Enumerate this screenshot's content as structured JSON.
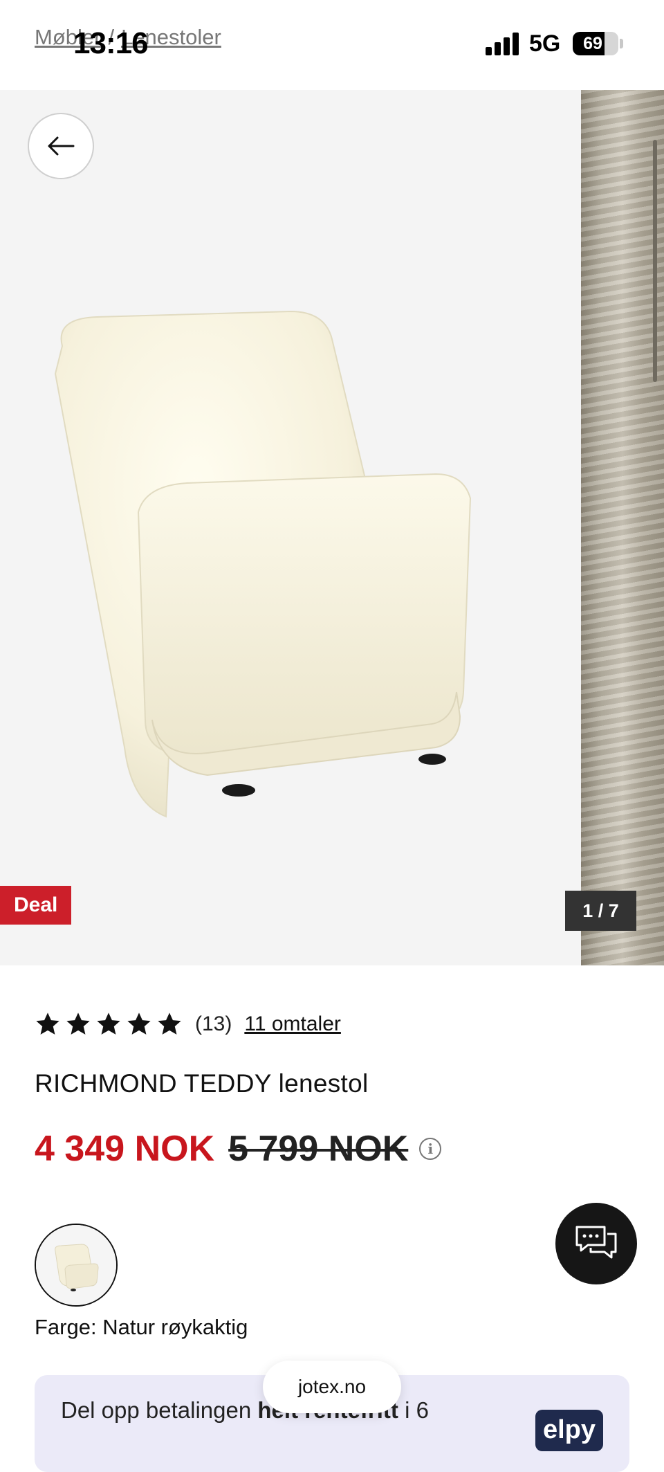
{
  "status_bar": {
    "time": "13:16",
    "network": "5G",
    "battery": "69",
    "battery_fraction": 0.69
  },
  "breadcrumb": {
    "items": [
      "Møbler",
      "Lenestoler"
    ],
    "separator": "/"
  },
  "gallery": {
    "counter": "1 / 7",
    "deal_badge": "Deal",
    "back_icon": "arrow-left-icon"
  },
  "product": {
    "rating": {
      "stars": 5,
      "count_text": "(13)",
      "reviews_link": "11 omtaler"
    },
    "title": "RICHMOND TEDDY lenestol",
    "price_now": "4 349 NOK",
    "price_old": "5 799 NOK",
    "color_label": "Farge: Natur røykaktig"
  },
  "payment_banner": {
    "text_prefix": "Del opp betalingen ",
    "text_bold": "helt rentefritt",
    "text_suffix": " i 6",
    "logo": "elpy"
  },
  "browser": {
    "url": "jotex.no"
  },
  "colors": {
    "deal": "#cc1f2a",
    "price": "#c8161d",
    "banner": "#ebeaf8",
    "chat": "#161616"
  }
}
